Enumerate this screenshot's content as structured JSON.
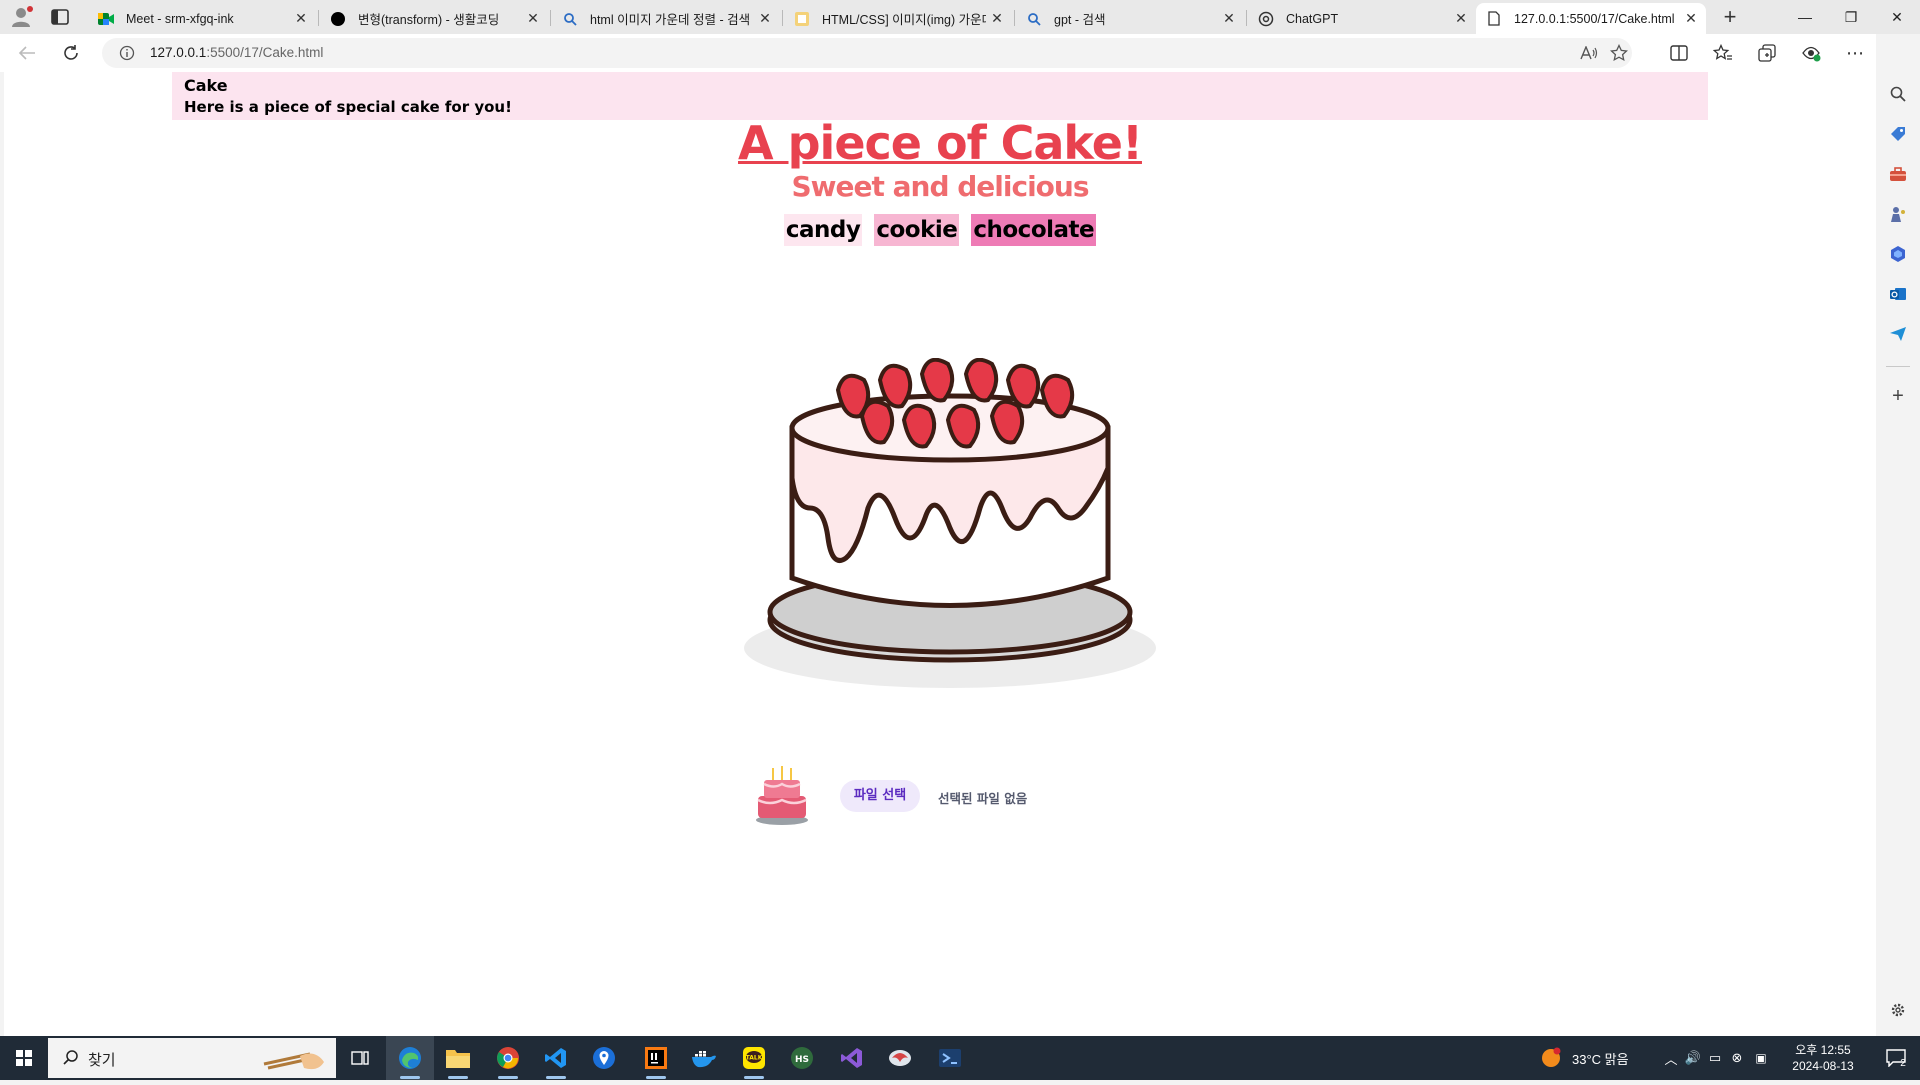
{
  "browser": {
    "tabs": [
      {
        "title": "Meet - srm-xfgq-ink",
        "icon": "google-meet-icon"
      },
      {
        "title": "변형(transform) - 생활코딩",
        "icon": "opentutorials-icon"
      },
      {
        "title": "html 이미지 가운데 정렬 - 검색",
        "icon": "bing-search-icon"
      },
      {
        "title": "HTML/CSS] 이미지(img) 가운데",
        "icon": "blog-icon"
      },
      {
        "title": "gpt - 검색",
        "icon": "bing-search-icon"
      },
      {
        "title": "ChatGPT",
        "icon": "chatgpt-icon"
      },
      {
        "title": "127.0.0.1:5500/17/Cake.html",
        "icon": "page-icon"
      }
    ],
    "close_glyph": "✕",
    "newtab_glyph": "+",
    "window_controls": {
      "minimize": "—",
      "restore": "❐",
      "close": "✕"
    },
    "url_host": "127.0.0.1",
    "url_rest": ":5500/17/Cake.html"
  },
  "page": {
    "header_title": "Cake",
    "header_subtitle": "Here is a piece of special cake for you!",
    "main_title": "A piece of Cake!",
    "sub_title": "Sweet and delicious",
    "tags": [
      {
        "label": "candy",
        "color": "#fde6ef"
      },
      {
        "label": "cookie",
        "color": "#f7b6d2"
      },
      {
        "label": "chocolate",
        "color": "#ee7bb5"
      }
    ],
    "file_button": "파일 선택",
    "file_status": "선택된 파일 없음"
  },
  "taskbar": {
    "search_placeholder": "찾기",
    "weather": "33°C  맑음",
    "time": "오후 12:55",
    "date": "2024-08-13",
    "notification_count": "2"
  },
  "colors": {
    "title_red": "#e8424f",
    "subtitle_red": "#ef6c6f",
    "header_pink": "#fce4ef",
    "file_button_text": "#5b2bc0"
  }
}
